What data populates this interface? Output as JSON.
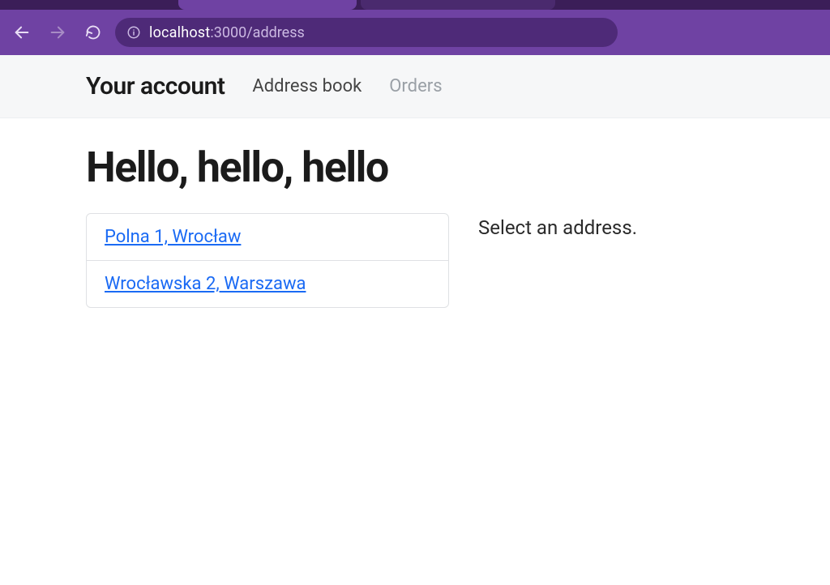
{
  "browser": {
    "url_host": "localhost",
    "url_rest": ":3000/address"
  },
  "subnav": {
    "brand": "Your account",
    "links": [
      {
        "label": "Address book"
      },
      {
        "label": "Orders"
      }
    ]
  },
  "page": {
    "heading": "Hello, hello, hello",
    "side_text": "Select an address.",
    "addresses": [
      {
        "label": "Polna 1, Wrocław"
      },
      {
        "label": "Wrocławska 2, Warszawa"
      }
    ]
  }
}
